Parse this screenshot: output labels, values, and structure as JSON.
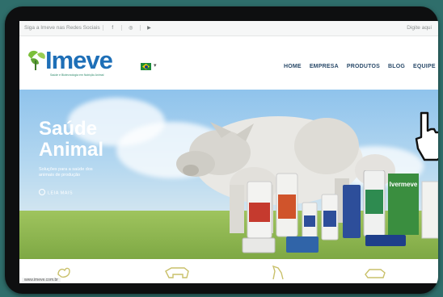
{
  "topbar": {
    "social_text": "Siga a Imeve nas Redes Sociais",
    "icons": [
      "facebook-icon",
      "instagram-icon",
      "youtube-icon"
    ],
    "icon_glyphs": [
      "f",
      "◎",
      "▶"
    ],
    "right_text": "Digite aqui"
  },
  "brand": {
    "name": "Imeve",
    "tagline": "Saúde e Biotecnologia em Nutrição Animal",
    "primary": "#1e6fb7",
    "green": "#7bbf3a"
  },
  "nav": {
    "items": [
      "HOME",
      "EMPRESA",
      "PRODUTOS",
      "BLOG",
      "EQUIPE"
    ]
  },
  "hero": {
    "title": "Saúde Animal",
    "subtitle": "Soluções para a saúde dos animais de produção",
    "cta": "LEIA MAIS"
  },
  "products": {
    "label": "Ivermeve"
  },
  "footer": {
    "url": "www.imeve.com.br",
    "categories": [
      "poultry-icon",
      "cattle-icon",
      "horse-icon",
      "pet-icon"
    ]
  },
  "colors": {
    "frame": "#0e0f10",
    "background": "#2f6e6b",
    "nav_text": "#2b4b6a"
  }
}
